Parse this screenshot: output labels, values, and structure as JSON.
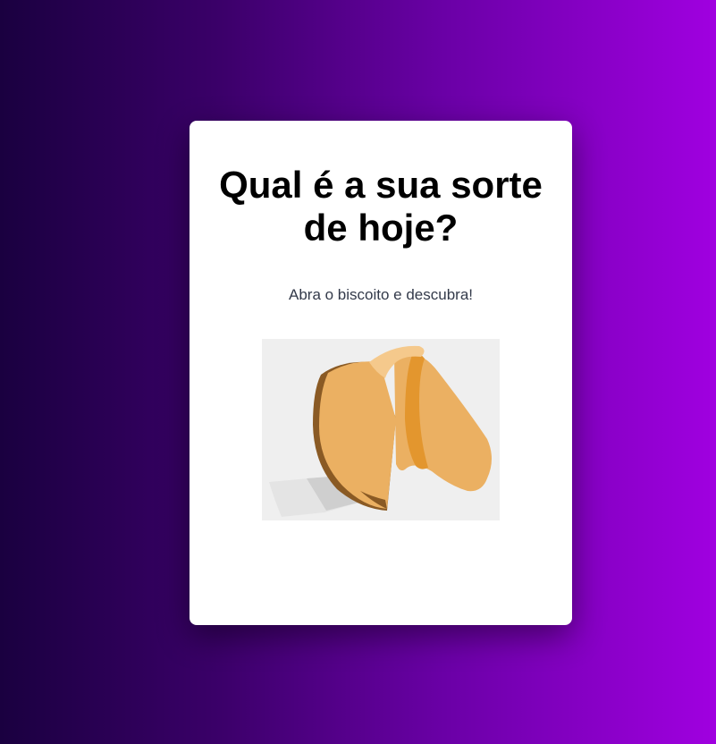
{
  "card": {
    "title": "Qual é a sua sorte de hoje?",
    "subtitle": "Abra o biscoito e descubra!"
  },
  "cookie": {
    "icon": "fortune-cookie-icon"
  },
  "colors": {
    "background_start": "#1a0040",
    "background_end": "#a000e0",
    "card": "#ffffff",
    "cookie_body": "#ebb062",
    "cookie_shadow": "#8a5a24",
    "cookie_fold": "#e3962e",
    "paper": "#d4d4d4"
  }
}
